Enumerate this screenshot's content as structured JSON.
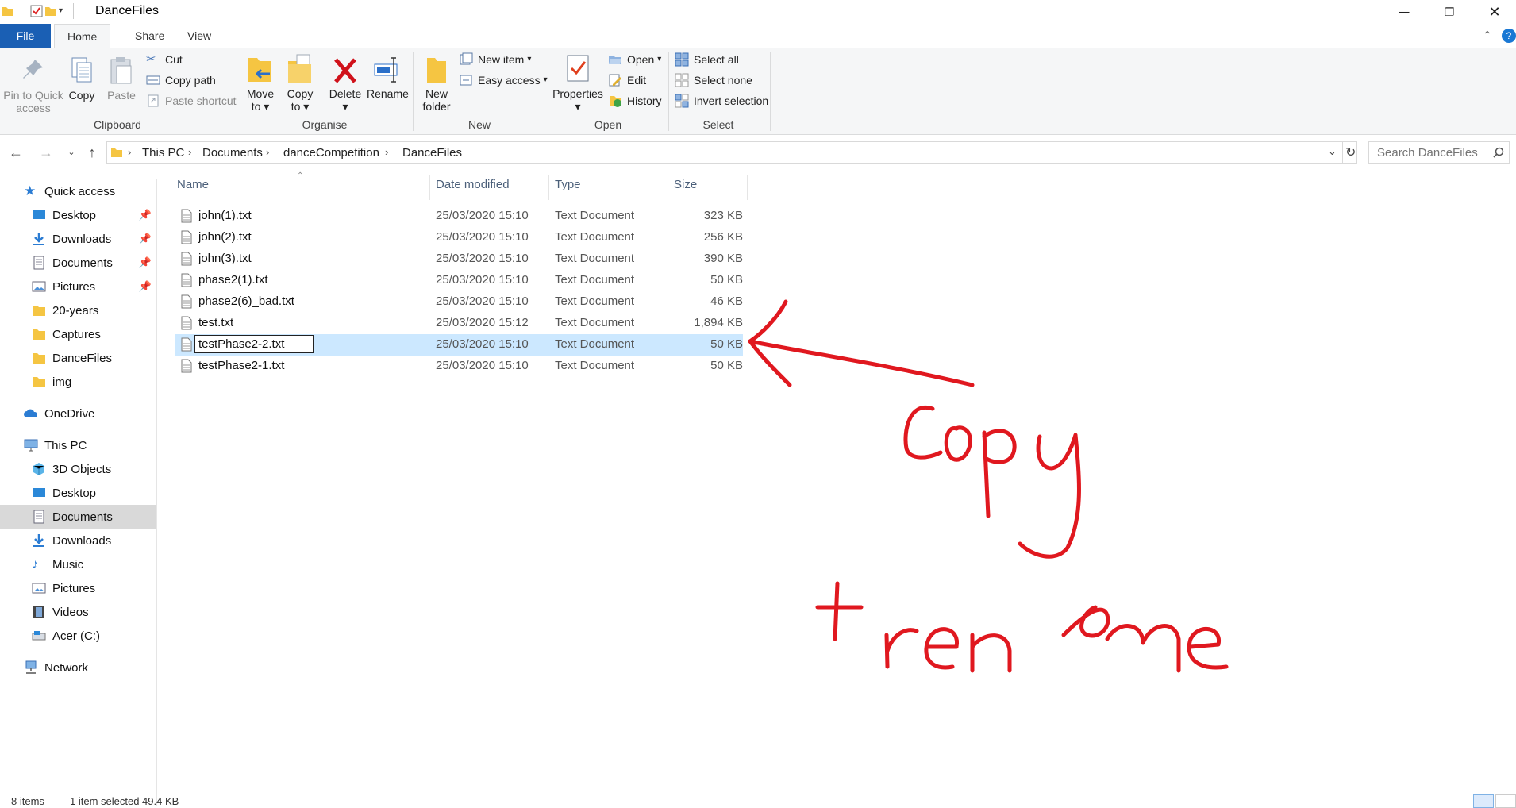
{
  "window": {
    "title": "DanceFiles"
  },
  "ribbon_tabs": {
    "file": "File",
    "home": "Home",
    "share": "Share",
    "view": "View"
  },
  "ribbon": {
    "clipboard": {
      "label": "Clipboard",
      "pin": "Pin to Quick access",
      "pin_line1": "Pin to Quick",
      "pin_line2": "access",
      "copy": "Copy",
      "paste": "Paste",
      "cut": "Cut",
      "copy_path": "Copy path",
      "paste_shortcut": "Paste shortcut"
    },
    "organise": {
      "label": "Organise",
      "move_to_1": "Move",
      "move_to_2": "to",
      "copy_to_1": "Copy",
      "copy_to_2": "to",
      "delete": "Delete",
      "rename": "Rename"
    },
    "new": {
      "label": "New",
      "new_folder_1": "New",
      "new_folder_2": "folder",
      "new_item": "New item",
      "easy_access": "Easy access"
    },
    "open": {
      "label": "Open",
      "properties": "Properties",
      "open": "Open",
      "edit": "Edit",
      "history": "History"
    },
    "select": {
      "label": "Select",
      "select_all": "Select all",
      "select_none": "Select none",
      "invert": "Invert selection"
    }
  },
  "address": {
    "crumbs": [
      "This PC",
      "Documents",
      "danceCompetition",
      "DanceFiles"
    ],
    "search_placeholder": "Search DanceFiles"
  },
  "sidebar": {
    "quick_access": "Quick access",
    "quick_items": [
      "Desktop",
      "Downloads",
      "Documents",
      "Pictures",
      "20-years",
      "Captures",
      "DanceFiles",
      "img"
    ],
    "onedrive": "OneDrive",
    "this_pc": "This PC",
    "pc_items": [
      "3D Objects",
      "Desktop",
      "Documents",
      "Downloads",
      "Music",
      "Pictures",
      "Videos",
      "Acer (C:)"
    ],
    "network": "Network"
  },
  "columns": {
    "name": "Name",
    "date": "Date modified",
    "type": "Type",
    "size": "Size"
  },
  "files": [
    {
      "name": "john(1).txt",
      "date": "25/03/2020 15:10",
      "type": "Text Document",
      "size": "323 KB"
    },
    {
      "name": "john(2).txt",
      "date": "25/03/2020 15:10",
      "type": "Text Document",
      "size": "256 KB"
    },
    {
      "name": "john(3).txt",
      "date": "25/03/2020 15:10",
      "type": "Text Document",
      "size": "390 KB"
    },
    {
      "name": "phase2(1).txt",
      "date": "25/03/2020 15:10",
      "type": "Text Document",
      "size": "50 KB"
    },
    {
      "name": "phase2(6)_bad.txt",
      "date": "25/03/2020 15:10",
      "type": "Text Document",
      "size": "46 KB"
    },
    {
      "name": "test.txt",
      "date": "25/03/2020 15:12",
      "type": "Text Document",
      "size": "1,894 KB"
    },
    {
      "name": "testPhase2-2.txt",
      "date": "25/03/2020 15:10",
      "type": "Text Document",
      "size": "50 KB"
    },
    {
      "name": "testPhase2-1.txt",
      "date": "25/03/2020 15:10",
      "type": "Text Document",
      "size": "50 KB"
    }
  ],
  "status": {
    "count": "8 items",
    "selection": "1 item selected 49.4 KB"
  },
  "colors": {
    "accent": "#1a5fb4",
    "selection": "#cce8ff",
    "annotation": "#e0181f"
  }
}
